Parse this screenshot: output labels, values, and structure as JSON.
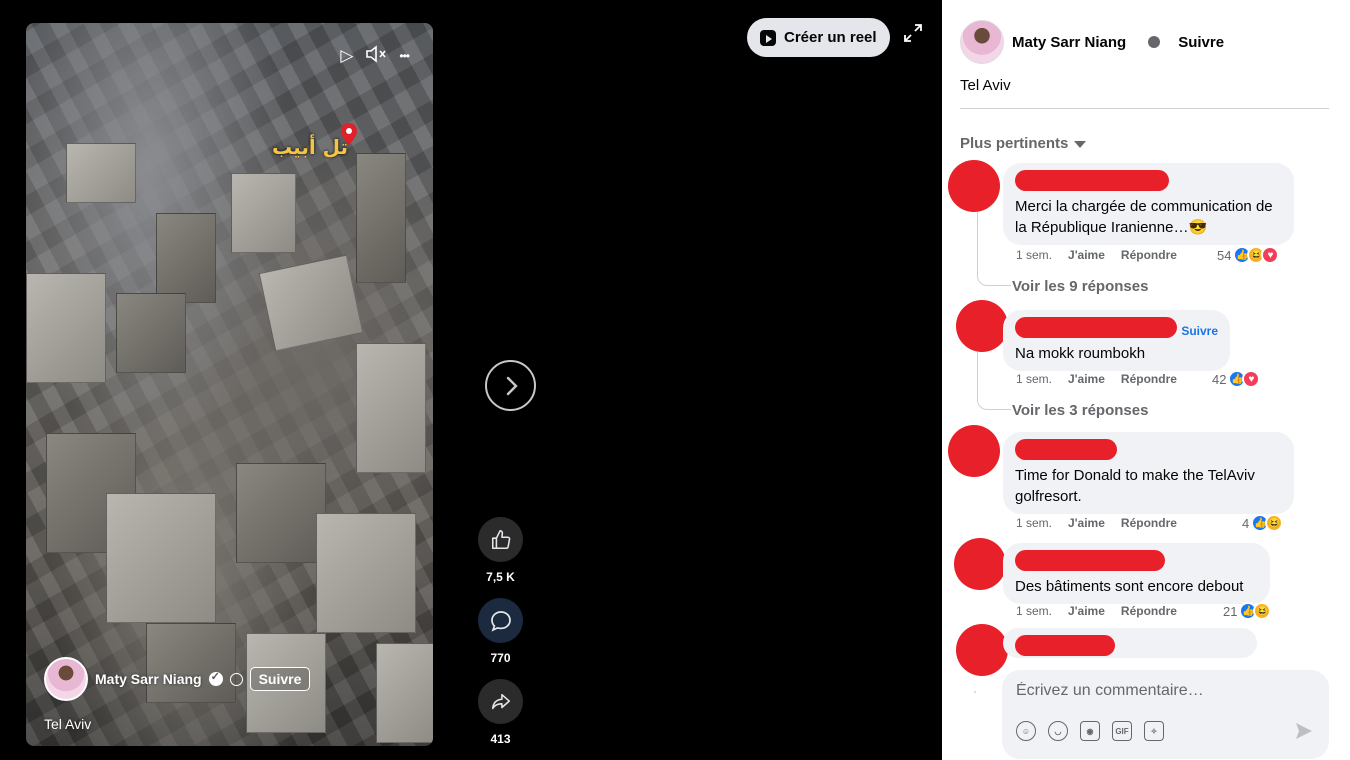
{
  "video": {
    "overlay_place_label": "تل أبيب",
    "author_name": "Maty Sarr Niang",
    "follow_label": "Suivre",
    "caption": "Tel Aviv",
    "controls": {
      "play": "▷",
      "mute": "🔇",
      "more": "•••"
    }
  },
  "actions": {
    "likes": "7,5 K",
    "comments": "770",
    "shares": "413"
  },
  "create_reel_label": "Créer un reel",
  "panel": {
    "author_name": "Maty Sarr Niang",
    "follow_label": "Suivre",
    "caption": "Tel Aviv",
    "sort_label": "Plus pertinents"
  },
  "comments": [
    {
      "text": "Merci la chargée de communication de la République Iranienne…😎",
      "time": "1 sem.",
      "like": "J'aime",
      "reply": "Répondre",
      "reactions_count": "54",
      "replies_label": "Voir les 9 réponses"
    },
    {
      "text": "Na mokk roumbokh",
      "follow": "Suivre",
      "time": "1 sem.",
      "like": "J'aime",
      "reply": "Répondre",
      "reactions_count": "42",
      "replies_label": "Voir les 3 réponses"
    },
    {
      "text": "Time for Donald to make the TelAviv golfresort.",
      "time": "1 sem.",
      "like": "J'aime",
      "reply": "Répondre",
      "reactions_count": "4"
    },
    {
      "text": "Des bâtiments sont encore debout",
      "time": "1 sem.",
      "like": "J'aime",
      "reply": "Répondre",
      "reactions_count": "21"
    }
  ],
  "composer": {
    "placeholder": "Écrivez un commentaire…",
    "tools": [
      "avatar-sticker-icon",
      "emoji-icon",
      "camera-icon",
      "gif-icon",
      "sticker-icon"
    ],
    "gif_label": "GIF"
  },
  "colors": {
    "redaction": "#e8202a",
    "link_blue": "#1b74e4",
    "bubble_bg": "#f0f2f5",
    "muted_text": "#65676b"
  }
}
